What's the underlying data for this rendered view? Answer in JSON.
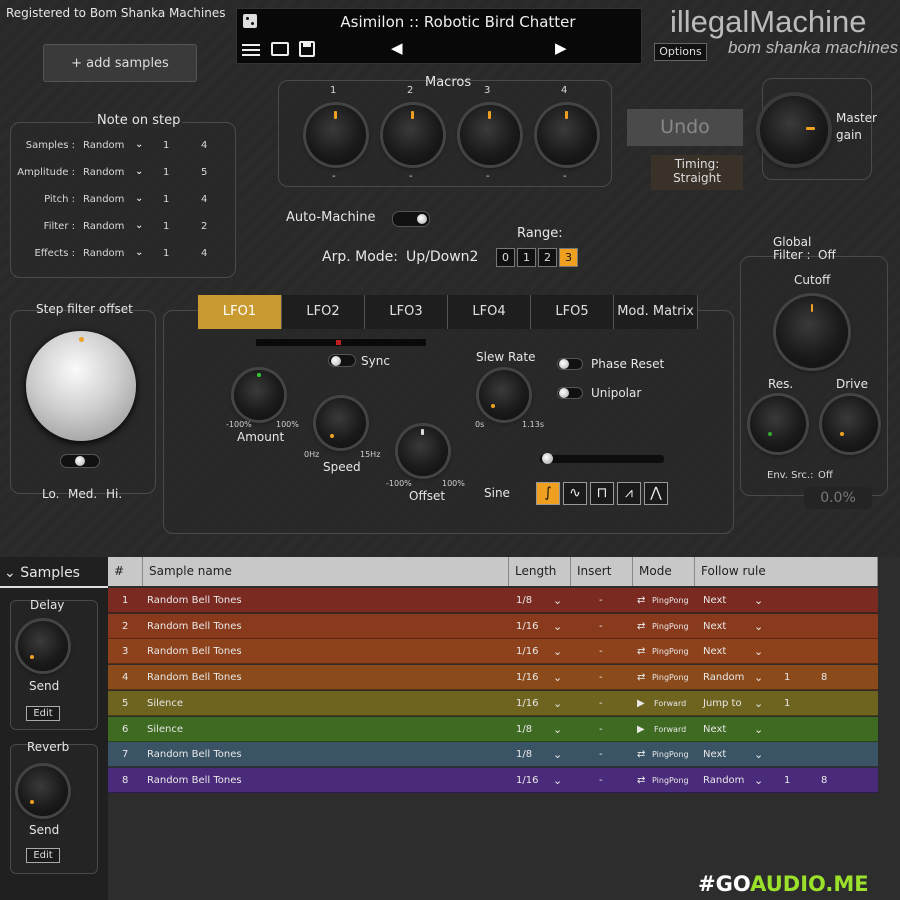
{
  "header": {
    "registered": "Registered to Bom Shanka Machines",
    "preset_name": "Asimilon :: Robotic Bird Chatter",
    "prev_arrow": "◀",
    "next_arrow": "▶",
    "options": "Options",
    "brand": "illegalMachine",
    "brand_sub": "bom shanka machines",
    "add_samples": "+ add samples"
  },
  "note_on_step": {
    "title": "Note on step",
    "rows": [
      {
        "label": "Samples :",
        "mode": "Random",
        "a": "1",
        "b": "4"
      },
      {
        "label": "Amplitude :",
        "mode": "Random",
        "a": "1",
        "b": "5"
      },
      {
        "label": "Pitch :",
        "mode": "Random",
        "a": "1",
        "b": "4"
      },
      {
        "label": "Filter :",
        "mode": "Random",
        "a": "1",
        "b": "2"
      },
      {
        "label": "Effects :",
        "mode": "Random",
        "a": "1",
        "b": "4"
      }
    ]
  },
  "macros": {
    "title": "Macros",
    "knobs": [
      {
        "num": "1",
        "val": "-"
      },
      {
        "num": "2",
        "val": "-"
      },
      {
        "num": "3",
        "val": "-"
      },
      {
        "num": "4",
        "val": "-"
      }
    ]
  },
  "undo": "Undo",
  "timing": {
    "label": "Timing:",
    "value": "Straight"
  },
  "master_gain": {
    "line1": "Master",
    "line2": "gain"
  },
  "auto_machine": "Auto-Machine",
  "arp": {
    "label": "Arp. Mode:",
    "value": "Up/Down2",
    "range_label": "Range:",
    "range_options": [
      "0",
      "1",
      "2",
      "3"
    ],
    "range_selected": "3"
  },
  "global_filter": {
    "title_line1": "Global",
    "title_line2": "Filter :",
    "state": "Off",
    "cutoff": "Cutoff",
    "res": "Res.",
    "drive": "Drive",
    "env_src_label": "Env. Src.:",
    "env_src_value": "Off",
    "percent": "0.0%"
  },
  "step_filter": {
    "title": "Step filter offset",
    "lo": "Lo.",
    "med": "Med.",
    "hi": "Hi."
  },
  "lfo": {
    "tabs": [
      "LFO1",
      "LFO2",
      "LFO3",
      "LFO4",
      "LFO5",
      "Mod. Matrix"
    ],
    "active_tab": "LFO1",
    "sync": "Sync",
    "amount": "Amount",
    "amount_min": "-100%",
    "amount_max": "100%",
    "speed": "Speed",
    "speed_min": "0Hz",
    "speed_max": "15Hz",
    "offset": "Offset",
    "offset_min": "-100%",
    "offset_max": "100%",
    "slew_rate": "Slew Rate",
    "slew_min": "0s",
    "slew_max": "1.13s",
    "phase_reset": "Phase Reset",
    "unipolar": "Unipolar",
    "shape_label": "Sine"
  },
  "samples_panel": {
    "title": "Samples",
    "delay": "Delay",
    "send1": "Send",
    "edit1": "Edit",
    "reverb": "Reverb",
    "send2": "Send",
    "edit2": "Edit"
  },
  "table": {
    "headers": [
      "#",
      "Sample name",
      "Length",
      "Insert",
      "Mode",
      "Follow rule"
    ],
    "rows": [
      {
        "n": "1",
        "name": "Random Bell Tones",
        "length": "1/8",
        "insert": "-",
        "mode": "PingPong",
        "rule": "Next",
        "p1": "",
        "p2": "",
        "color": "#7a2a20"
      },
      {
        "n": "2",
        "name": "Random Bell Tones",
        "length": "1/16",
        "insert": "-",
        "mode": "PingPong",
        "rule": "Next",
        "p1": "",
        "p2": "",
        "color": "#8a3a1c"
      },
      {
        "n": "3",
        "name": "Random Bell Tones",
        "length": "1/16",
        "insert": "-",
        "mode": "PingPong",
        "rule": "Next",
        "p1": "",
        "p2": "",
        "color": "#8e421c"
      },
      {
        "n": "4",
        "name": "Random Bell Tones",
        "length": "1/16",
        "insert": "-",
        "mode": "PingPong",
        "rule": "Random",
        "p1": "1",
        "p2": "8",
        "color": "#8a4a1a"
      },
      {
        "n": "5",
        "name": "Silence",
        "length": "1/16",
        "insert": "-",
        "mode": "Forward",
        "rule": "Jump to",
        "p1": "1",
        "p2": "",
        "color": "#6e6420"
      },
      {
        "n": "6",
        "name": "Silence",
        "length": "1/8",
        "insert": "-",
        "mode": "Forward",
        "rule": "Next",
        "p1": "",
        "p2": "",
        "color": "#3e6a22"
      },
      {
        "n": "7",
        "name": "Random Bell Tones",
        "length": "1/8",
        "insert": "-",
        "mode": "PingPong",
        "rule": "Next",
        "p1": "",
        "p2": "",
        "color": "#3a5466"
      },
      {
        "n": "8",
        "name": "Random Bell Tones",
        "length": "1/16",
        "insert": "-",
        "mode": "PingPong",
        "rule": "Random",
        "p1": "1",
        "p2": "8",
        "color": "#4a2a7a"
      }
    ]
  },
  "watermark": {
    "part1": "#GO",
    "part2": "AUDIO.ME"
  },
  "colors": {
    "accent": "#f0a020",
    "tab_active": "#c99a30",
    "range_selected": "#f0a020"
  }
}
